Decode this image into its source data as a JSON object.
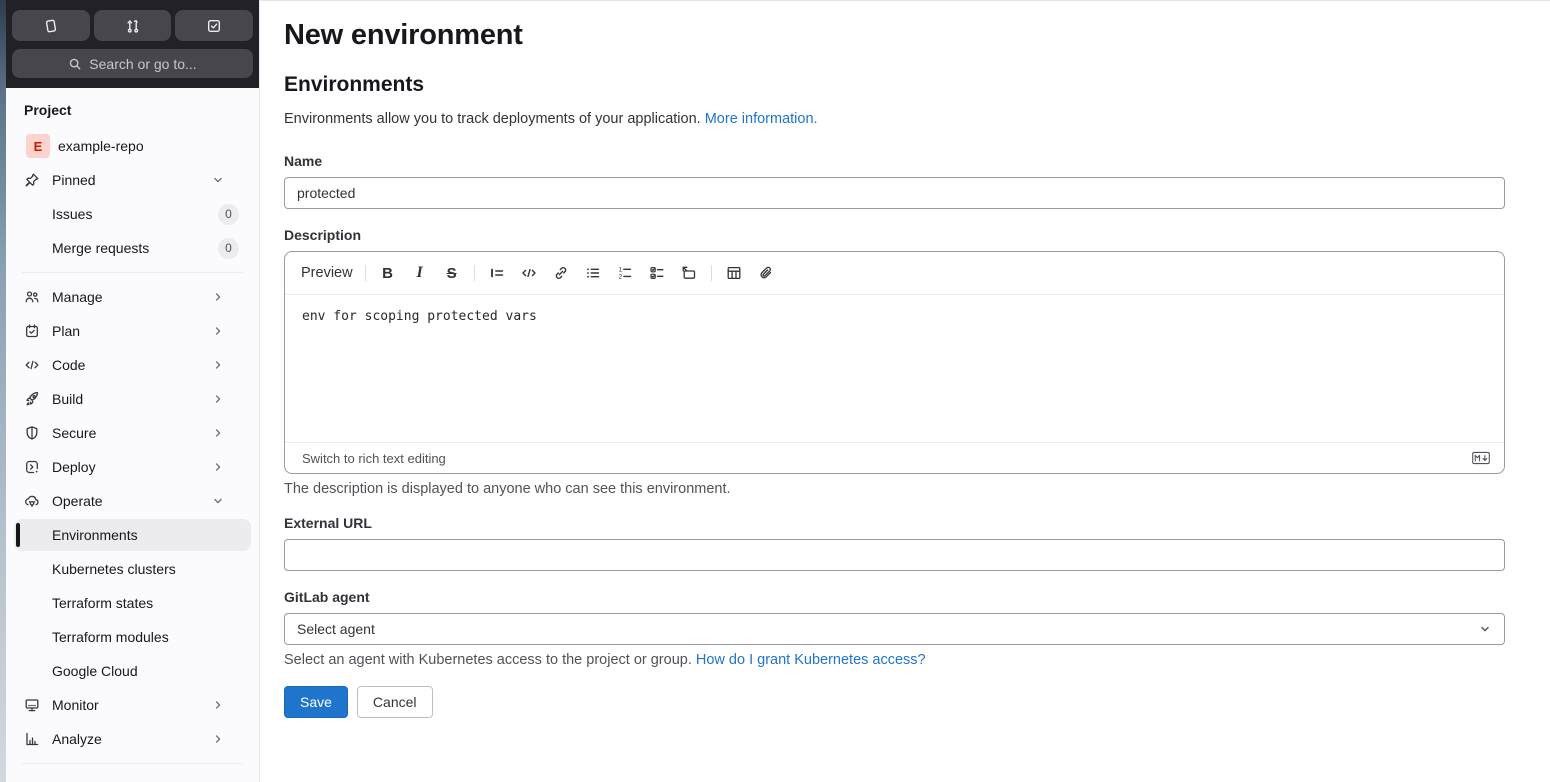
{
  "topbar": {
    "buttons": [
      {
        "name": "issues"
      },
      {
        "name": "merge-requests"
      },
      {
        "name": "todo-list"
      }
    ],
    "search_label": "Search or go to..."
  },
  "sidebar": {
    "section_label": "Project",
    "project": {
      "avatar_letter": "E",
      "name": "example-repo"
    },
    "pinned": {
      "label": "Pinned"
    },
    "pinned_items": [
      {
        "label": "Issues",
        "count": "0"
      },
      {
        "label": "Merge requests",
        "count": "0"
      }
    ],
    "nav": [
      {
        "label": "Manage",
        "icon": "users-icon"
      },
      {
        "label": "Plan",
        "icon": "calendar-icon"
      },
      {
        "label": "Code",
        "icon": "code-icon"
      },
      {
        "label": "Build",
        "icon": "rocket-icon"
      },
      {
        "label": "Secure",
        "icon": "shield-icon"
      },
      {
        "label": "Deploy",
        "icon": "deploy-icon"
      },
      {
        "label": "Operate",
        "icon": "cloud-pod-icon"
      }
    ],
    "subnav": [
      {
        "label": "Environments",
        "active": true
      },
      {
        "label": "Kubernetes clusters"
      },
      {
        "label": "Terraform states"
      },
      {
        "label": "Terraform modules"
      },
      {
        "label": "Google Cloud"
      }
    ],
    "nav_bottom": [
      {
        "label": "Monitor",
        "icon": "monitor-icon"
      },
      {
        "label": "Analyze",
        "icon": "chart-icon"
      }
    ]
  },
  "main": {
    "title": "New environment",
    "section_heading": "Environments",
    "intro_text": "Environments allow you to track deployments of your application.",
    "intro_link": "More information.",
    "name": {
      "label": "Name",
      "value": "protected"
    },
    "description": {
      "label": "Description",
      "preview_label": "Preview",
      "toolbar_icons": [
        "bold-icon",
        "italic-icon",
        "strikethrough-icon",
        "quote-icon",
        "code-icon",
        "link-icon",
        "bullet-list-icon",
        "numbered-list-icon",
        "task-list-icon",
        "collapsible-section-icon",
        "table-icon",
        "attach-file-icon"
      ],
      "value": "env for scoping protected vars",
      "footer_link": "Switch to rich text editing",
      "markdown_icon": "markdown-icon",
      "help_text": "The description is displayed to anyone who can see this environment."
    },
    "external_url": {
      "label": "External URL",
      "value": ""
    },
    "agent": {
      "label": "GitLab agent",
      "selected": "Select agent",
      "help_text": "Select an agent with Kubernetes access to the project or group.",
      "help_link": "How do I grant Kubernetes access?"
    },
    "actions": {
      "save": "Save",
      "cancel": "Cancel"
    }
  },
  "colors": {
    "accent_blue": "#1f75cb",
    "topbar_bg": "#222127",
    "topbar_button_bg": "#47464c",
    "sidebar_bg": "#fbfafd",
    "active_item_bg": "#ececef",
    "avatar_bg": "#fdd4cd",
    "avatar_text": "#c91c00"
  }
}
